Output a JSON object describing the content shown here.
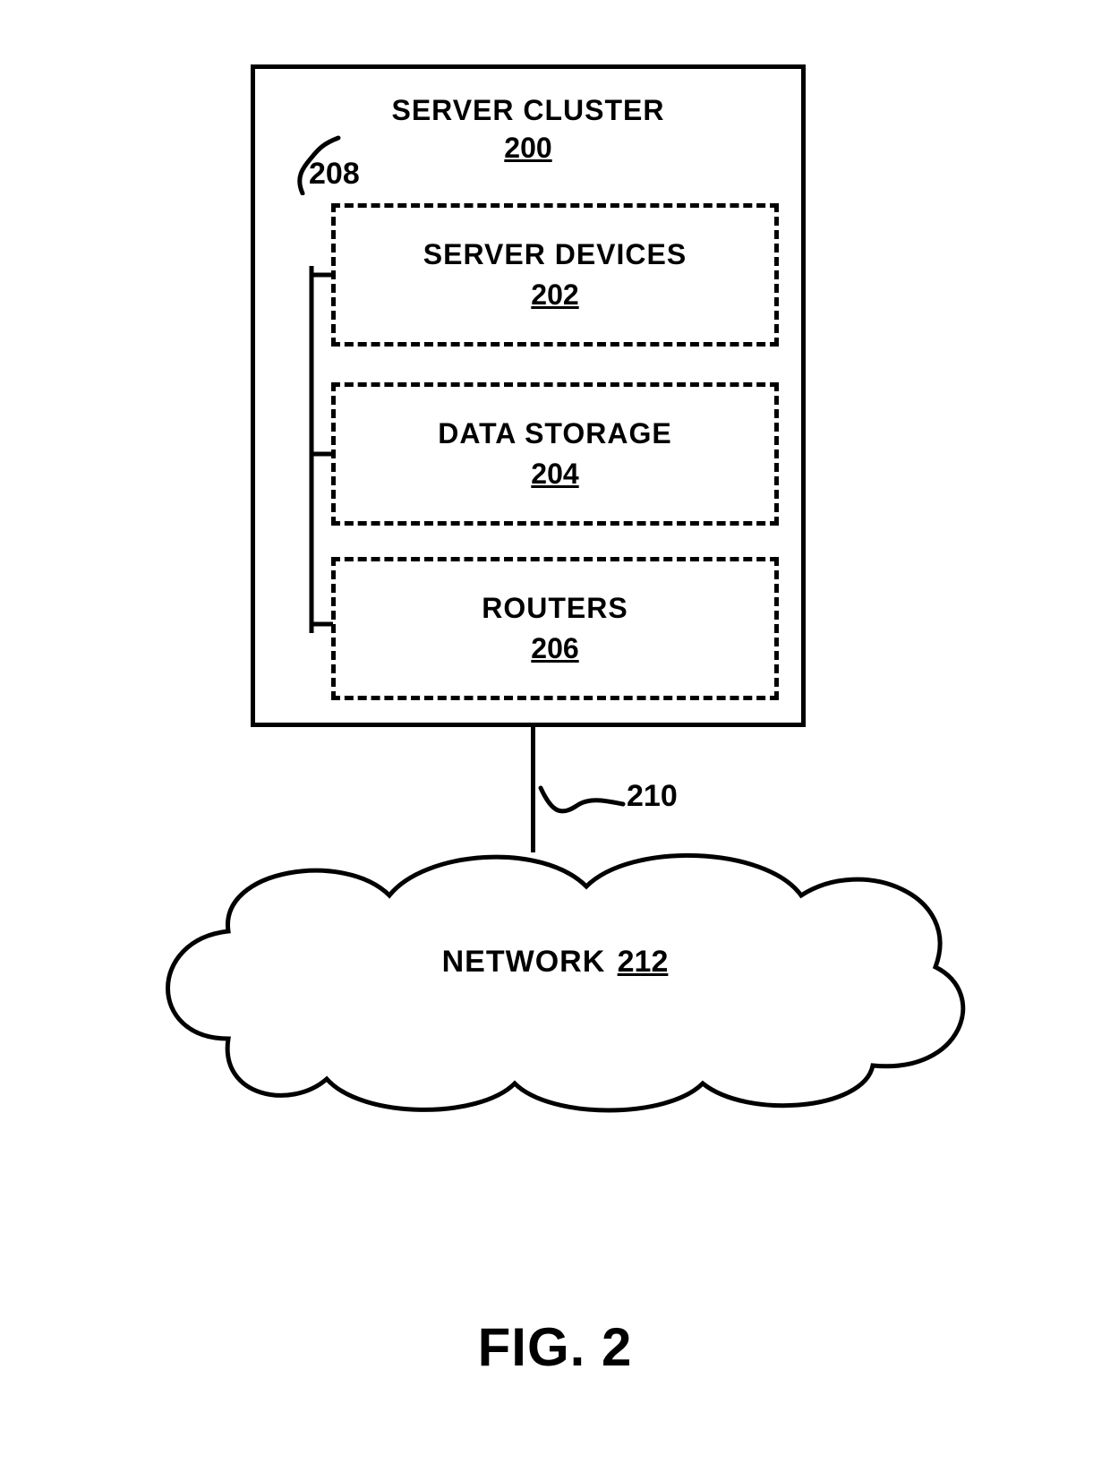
{
  "cluster": {
    "title": "SERVER CLUSTER",
    "ref": "200",
    "bus_ref": "208",
    "link_ref": "210",
    "boxes": [
      {
        "label": "SERVER DEVICES",
        "ref": "202"
      },
      {
        "label": "DATA STORAGE",
        "ref": "204"
      },
      {
        "label": "ROUTERS",
        "ref": "206"
      }
    ]
  },
  "network": {
    "label": "NETWORK",
    "ref": "212"
  },
  "figure": {
    "caption": "FIG. 2"
  },
  "colors": {
    "stroke": "#000000",
    "bg": "#ffffff"
  }
}
